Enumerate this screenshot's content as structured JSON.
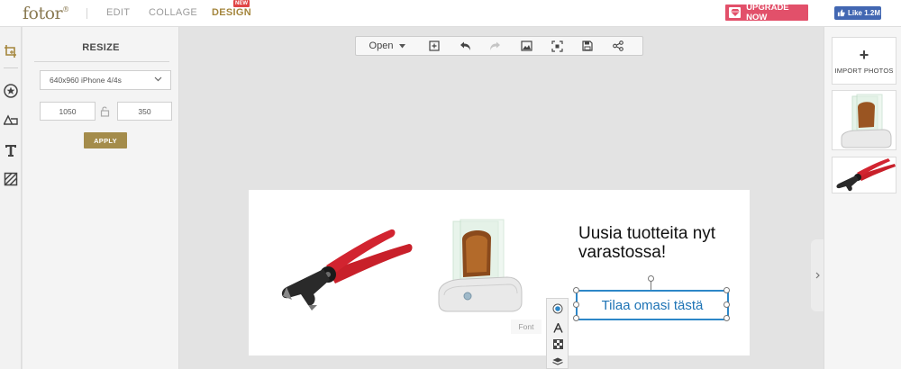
{
  "app": {
    "logo": "fotor",
    "nav": {
      "edit": "EDIT",
      "collage": "COLLAGE",
      "design": "DESIGN",
      "new_badge": "NEW"
    },
    "upgrade": "UPGRADE NOW",
    "fb_like": "Like 1.2M"
  },
  "panel": {
    "title": "RESIZE",
    "preset": "640x960 iPhone 4/4s",
    "width": "1050",
    "height": "350",
    "apply": "APPLY"
  },
  "toolbar": {
    "open": "Open"
  },
  "canvas": {
    "headline": "Uusia tuotteita nyt varastossa!",
    "textbox": "Tilaa omasi tästä",
    "font_label": "Font"
  },
  "right": {
    "import": "IMPORT PHOTOS"
  },
  "colors": {
    "accent": "#a4863d",
    "upgrade": "#e2506a",
    "selection": "#2d87c8",
    "pliers": "#c8202a"
  }
}
